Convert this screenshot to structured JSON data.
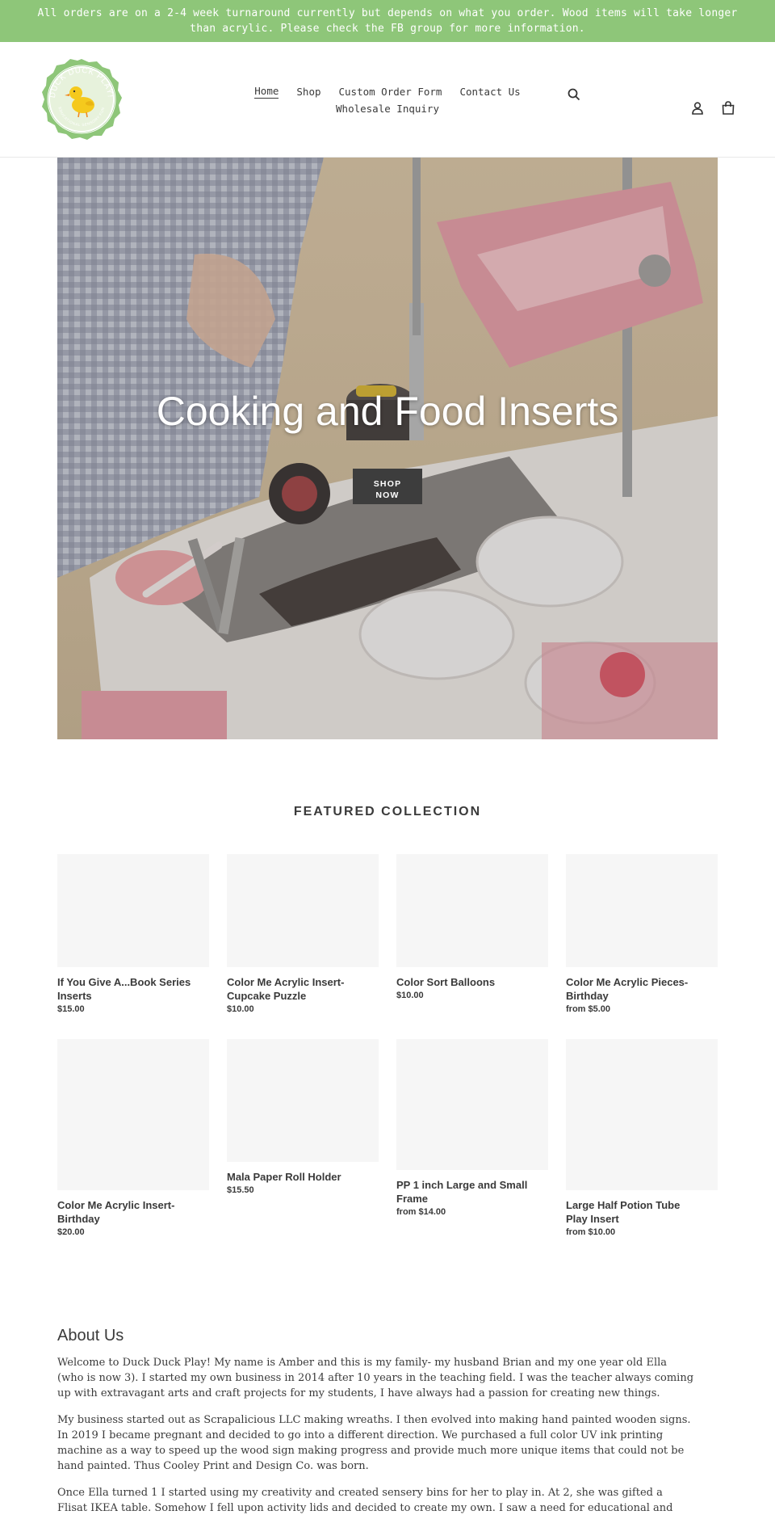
{
  "announcement": {
    "text": "All orders are on a 2-4 week turnaround currently but depends on what you order. Wood items will take longer than acrylic. Please check the FB group for more information."
  },
  "header": {
    "logo_text_top": "DUCK DUCK PLAY!",
    "logo_text_bottom": "EDUCATIONAL SENSORY FUN",
    "nav": {
      "home": "Home",
      "shop": "Shop",
      "custom_order": "Custom Order Form",
      "contact": "Contact Us",
      "wholesale": "Wholesale Inquiry"
    },
    "icons": [
      "search-icon",
      "account-icon",
      "cart-icon"
    ]
  },
  "hero": {
    "title": "Cooking and Food Inserts",
    "button_line1": "SHOP",
    "button_line2": "NOW"
  },
  "featured": {
    "title": "FEATURED COLLECTION",
    "products": [
      {
        "name": "If You Give A...Book Series Inserts",
        "price": "$15.00"
      },
      {
        "name": "Color Me Acrylic Insert- Cupcake Puzzle",
        "price": "$10.00"
      },
      {
        "name": "Color Sort Balloons",
        "price": "$10.00"
      },
      {
        "name": "Color Me Acrylic Pieces- Birthday",
        "price": "from $5.00"
      },
      {
        "name": "Color Me Acrylic Insert- Birthday",
        "price": "$20.00"
      },
      {
        "name": "Mala Paper Roll Holder",
        "price": "$15.50"
      },
      {
        "name": "PP 1 inch Large and Small Frame",
        "price": "from $14.00"
      },
      {
        "name": "Large Half Potion Tube Play Insert",
        "price": "from $10.00"
      }
    ]
  },
  "about": {
    "title": "About Us",
    "paragraphs": [
      "Welcome to Duck Duck Play!  My name is Amber and this is my family- my husband Brian and my one year old Ella (who is now 3).  I started my own business in 2014 after 10 years in the teaching field.  I was the teacher always coming up with extravagant arts and craft projects for my students, I have always had a passion for creating new things.",
      "My business started out as Scrapalicious LLC making wreaths.  I then evolved into making hand painted wooden signs.  In 2019 I became pregnant and decided to go into a different direction.  We purchased a full color UV ink printing machine as a way to speed up the wood sign making progress and provide much more unique items that could not be hand painted.  Thus Cooley Print and Design Co. was born.",
      "Once Ella turned 1 I started using my creativity and created sensery bins for her to play in. At 2, she was gifted a Flisat IKEA table. Somehow I fell upon activity lids and decided to create my own. I saw a need for educational and"
    ]
  },
  "colors": {
    "announcement_bg": "#8ec679",
    "logo_green": "#8ec679",
    "button_dark": "#3d3d3d",
    "placeholder": "#f6f6f6"
  }
}
